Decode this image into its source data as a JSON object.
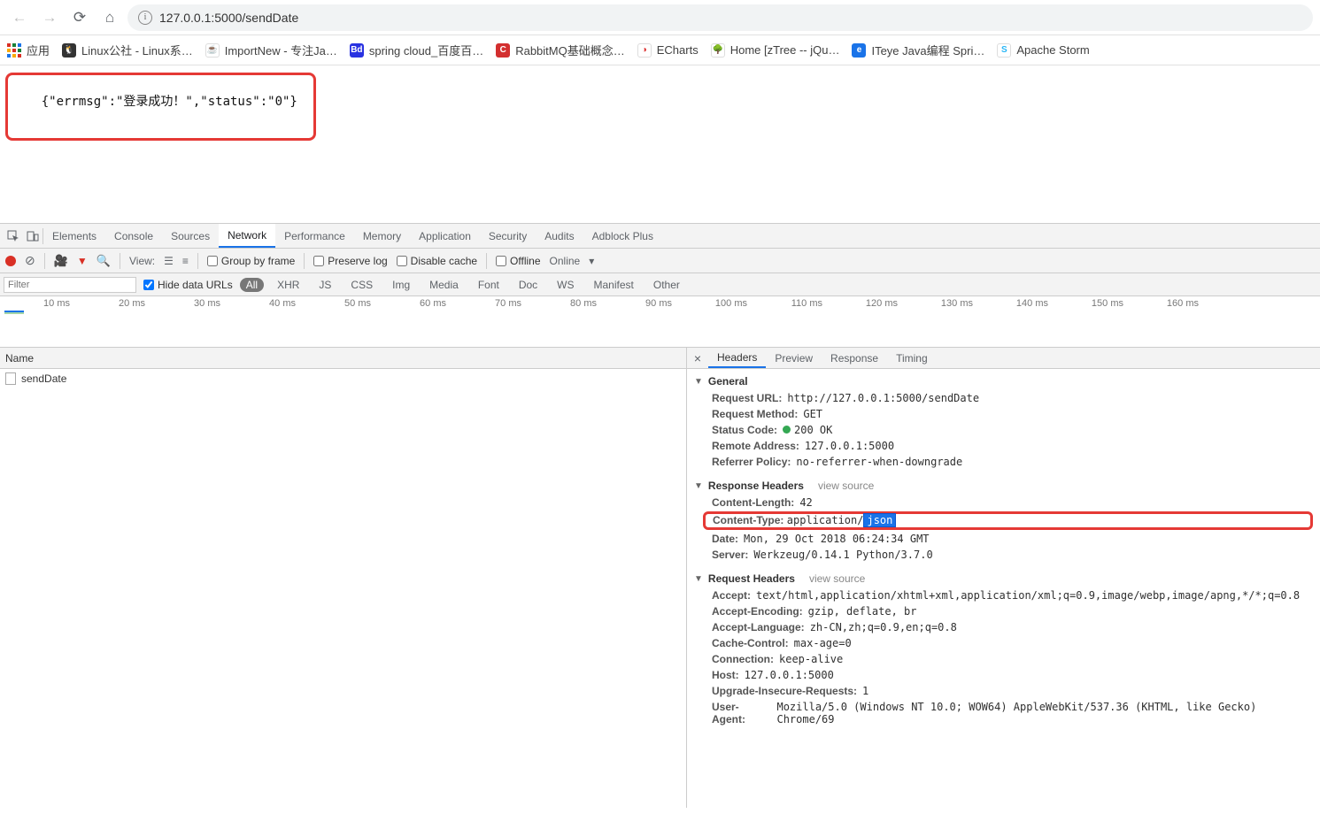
{
  "browser": {
    "address": "127.0.0.1:5000/sendDate"
  },
  "bookmarks": {
    "apps": "应用",
    "items": [
      "Linux公社 - Linux系…",
      "ImportNew - 专注Ja…",
      "spring cloud_百度百…",
      "RabbitMQ基础概念…",
      "ECharts",
      "Home [zTree -- jQu…",
      "ITeye Java编程 Spri…",
      "Apache Storm"
    ]
  },
  "page": {
    "json_text": "{\"errmsg\":\"登录成功！\",\"status\":\"0\"}"
  },
  "devtools": {
    "tabs": [
      "Elements",
      "Console",
      "Sources",
      "Network",
      "Performance",
      "Memory",
      "Application",
      "Security",
      "Audits",
      "Adblock Plus"
    ],
    "active_tab": "Network",
    "toolbar": {
      "view_label": "View:",
      "group": "Group by frame",
      "preserve": "Preserve log",
      "disable_cache": "Disable cache",
      "offline": "Offline",
      "online": "Online"
    },
    "filter": {
      "placeholder": "Filter",
      "hide_data": "Hide data URLs",
      "pills": [
        "All",
        "XHR",
        "JS",
        "CSS",
        "Img",
        "Media",
        "Font",
        "Doc",
        "WS",
        "Manifest",
        "Other"
      ]
    },
    "timeline": [
      "10 ms",
      "20 ms",
      "30 ms",
      "40 ms",
      "50 ms",
      "60 ms",
      "70 ms",
      "80 ms",
      "90 ms",
      "100 ms",
      "110 ms",
      "120 ms",
      "130 ms",
      "140 ms",
      "150 ms",
      "160 ms"
    ]
  },
  "requests": {
    "header": "Name",
    "items": [
      "sendDate"
    ]
  },
  "details": {
    "tabs": [
      "Headers",
      "Preview",
      "Response",
      "Timing"
    ],
    "active": "Headers",
    "general": {
      "title": "General",
      "request_url_k": "Request URL:",
      "request_url_v": "http://127.0.0.1:5000/sendDate",
      "request_method_k": "Request Method:",
      "request_method_v": "GET",
      "status_code_k": "Status Code:",
      "status_code_v": "200 OK",
      "remote_addr_k": "Remote Address:",
      "remote_addr_v": "127.0.0.1:5000",
      "referrer_k": "Referrer Policy:",
      "referrer_v": "no-referrer-when-downgrade"
    },
    "response_headers": {
      "title": "Response Headers",
      "view_src": "view source",
      "content_length_k": "Content-Length:",
      "content_length_v": "42",
      "content_type_k": "Content-Type:",
      "content_type_v_prefix": "application/",
      "content_type_v_hl": "json",
      "date_k": "Date:",
      "date_v": "Mon, 29 Oct 2018 06:24:34 GMT",
      "server_k": "Server:",
      "server_v": "Werkzeug/0.14.1 Python/3.7.0"
    },
    "request_headers": {
      "title": "Request Headers",
      "view_src": "view source",
      "accept_k": "Accept:",
      "accept_v": "text/html,application/xhtml+xml,application/xml;q=0.9,image/webp,image/apng,*/*;q=0.8",
      "accept_enc_k": "Accept-Encoding:",
      "accept_enc_v": "gzip, deflate, br",
      "accept_lang_k": "Accept-Language:",
      "accept_lang_v": "zh-CN,zh;q=0.9,en;q=0.8",
      "cache_k": "Cache-Control:",
      "cache_v": "max-age=0",
      "conn_k": "Connection:",
      "conn_v": "keep-alive",
      "host_k": "Host:",
      "host_v": "127.0.0.1:5000",
      "upgrade_k": "Upgrade-Insecure-Requests:",
      "upgrade_v": "1",
      "ua_k": "User-Agent:",
      "ua_v": "Mozilla/5.0 (Windows NT 10.0; WOW64) AppleWebKit/537.36 (KHTML, like Gecko) Chrome/69"
    }
  }
}
